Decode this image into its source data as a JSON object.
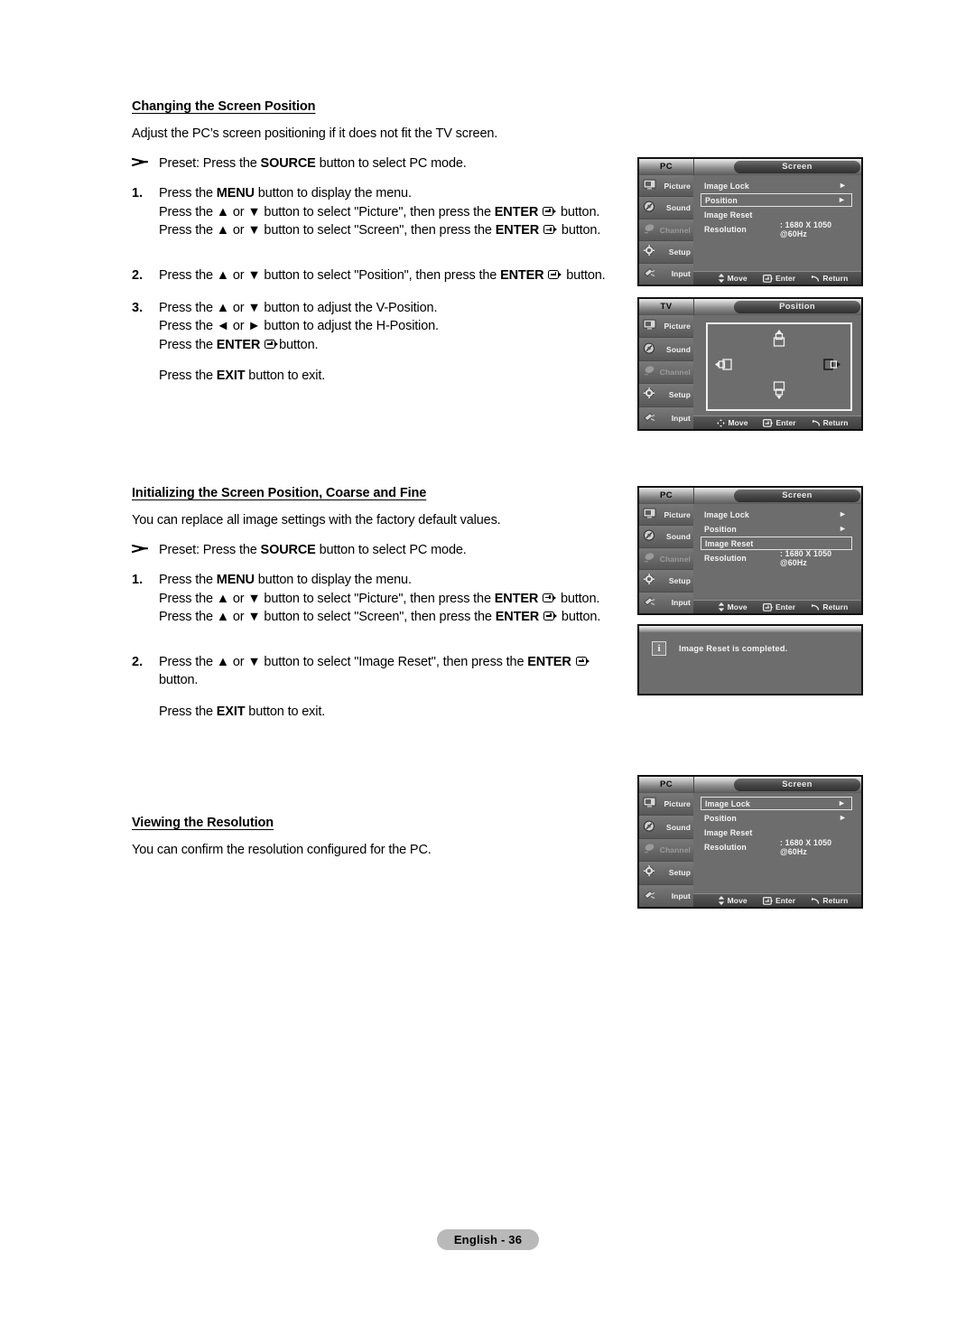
{
  "page": {
    "footer_label": "English - 36"
  },
  "sections": [
    {
      "heading": "Changing the Screen Position",
      "intro": "Adjust the PC’s screen positioning if it does not fit the TV screen.",
      "preset": "Preset: Press the SOURCE button to select PC mode.",
      "preset_pre": "Preset: Press the ",
      "preset_bold": "SOURCE",
      "preset_post": " button to select PC mode.",
      "steps": [
        {
          "num": "1.",
          "lines": [
            "Press the MENU button to display the menu.",
            "Press the ▲ or ▼ button to select \"Picture\", then press the ENTER button.",
            "Press the ▲ or ▼ button to select \"Screen\", then press the ENTER button."
          ]
        },
        {
          "num": "2.",
          "lines": [
            "Press the ▲ or ▼ button to select \"Position\", then press the ENTER button."
          ]
        },
        {
          "num": "3.",
          "lines": [
            "Press the ▲ or ▼ button to adjust the V-Position.",
            "Press the ◄ or ► button to adjust the H-Position.",
            "Press the ENTER button."
          ]
        }
      ],
      "exit": "Press the EXIT button to exit."
    },
    {
      "heading": "Initializing the Screen Position, Coarse and Fine",
      "intro": "You can replace all image settings with the factory default values.",
      "preset_pre": "Preset: Press the ",
      "preset_bold": "SOURCE",
      "preset_post": " button to select PC mode.",
      "steps": [
        {
          "num": "1.",
          "lines": [
            "Press the MENU button to display the menu.",
            "Press the ▲ or ▼ button to select \"Picture\", then press the ENTER button.",
            "Press the ▲ or ▼ button to select \"Screen\", then press the ENTER button."
          ]
        },
        {
          "num": "2.",
          "lines": [
            "Press the ▲ or ▼ button to select \"Image Reset\", then press the ENTER button."
          ]
        }
      ],
      "exit": "Press the EXIT button to exit."
    },
    {
      "heading": "Viewing the Resolution",
      "intro": "You can confirm the resolution configured for the PC.",
      "steps": [],
      "exit": ""
    }
  ],
  "text_fragments": {
    "press_the": "Press the ",
    "menu": "MENU",
    "menu_tail": " button to display the menu.",
    "or": " or ",
    "btn_select": " button to select ",
    "btn_adjust": " button to adjust the ",
    "then_press": ", then press the ",
    "enter": "ENTER",
    "button_tail": " button.",
    "button_only": "button.",
    "exit_pre": "Press the ",
    "exit_word": "EXIT",
    "exit_tail": " button to exit.",
    "q_picture": "\"Picture\"",
    "q_screen": "\"Screen\"",
    "q_position": "\"Position\"",
    "q_imagereset": "\"Image Reset\"",
    "vpos": "V-Position.",
    "hpos": "H-Position.",
    "up_arrow": "▲",
    "down_arrow": "▼",
    "left_arrow": "◄",
    "right_arrow": "►",
    "preset_bullet": "➤"
  },
  "osd": {
    "sidebar": [
      {
        "label": "Picture",
        "icon": "picture-icon",
        "disabled": false
      },
      {
        "label": "Sound",
        "icon": "sound-icon",
        "disabled": false
      },
      {
        "label": "Channel",
        "icon": "channel-icon",
        "disabled": true
      },
      {
        "label": "Setup",
        "icon": "setup-gear-icon",
        "disabled": false
      },
      {
        "label": "Input",
        "icon": "input-plug-icon",
        "disabled": false
      }
    ],
    "footer": {
      "move": "Move",
      "enter": "Enter",
      "return": "Return"
    },
    "panels": [
      {
        "id": "screen-menu-position-selected",
        "source": "PC",
        "title": "Screen",
        "selected": "Position",
        "rows": [
          {
            "label": "Image Lock",
            "value": "",
            "arrow": "►"
          },
          {
            "label": "Position",
            "value": "",
            "arrow": "►"
          },
          {
            "label": "Image Reset",
            "value": "",
            "arrow": ""
          },
          {
            "label": "Resolution",
            "value": ": 1680 X 1050 @60Hz",
            "arrow": ""
          }
        ]
      },
      {
        "id": "position-adjust",
        "source": "TV",
        "title": "Position",
        "selected": "",
        "rows": []
      },
      {
        "id": "screen-menu-imagereset-selected",
        "source": "PC",
        "title": "Screen",
        "selected": "Image Reset",
        "rows": [
          {
            "label": "Image Lock",
            "value": "",
            "arrow": "►"
          },
          {
            "label": "Position",
            "value": "",
            "arrow": "►"
          },
          {
            "label": "Image Reset",
            "value": "",
            "arrow": ""
          },
          {
            "label": "Resolution",
            "value": ": 1680 X 1050 @60Hz",
            "arrow": ""
          }
        ]
      },
      {
        "id": "screen-menu-imagelock-selected",
        "source": "PC",
        "title": "Screen",
        "selected": "Image Lock",
        "rows": [
          {
            "label": "Image Lock",
            "value": "",
            "arrow": "►"
          },
          {
            "label": "Position",
            "value": "",
            "arrow": "►"
          },
          {
            "label": "Image Reset",
            "value": "",
            "arrow": ""
          },
          {
            "label": "Resolution",
            "value": ": 1680 X 1050 @60Hz",
            "arrow": ""
          }
        ]
      }
    ],
    "info_dialog": {
      "icon": "info-icon",
      "message": "Image Reset is completed."
    }
  }
}
